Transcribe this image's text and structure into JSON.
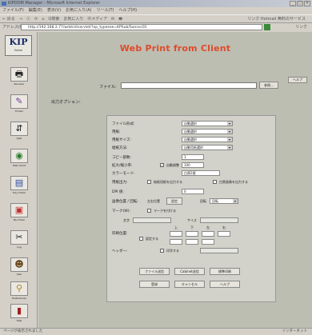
{
  "window": {
    "title": "KIPDOM Manager - Microsoft Internet Explorer"
  },
  "menubar": [
    "ファイル(F)",
    "編集(E)",
    "表示(V)",
    "お気に入り(A)",
    "ツール(T)",
    "ヘルプ(H)"
  ],
  "toolbar": {
    "items": [
      "← 戻る",
      "→",
      "ⓧ",
      "⟳",
      "⌂",
      "Q検索",
      "お気に入り",
      "Ⓜメディア",
      "✉",
      "🖶"
    ],
    "right": "リンク Hotmail 無料のサービス"
  },
  "address": {
    "label": "アドレス(D)",
    "url": "http://192.168.2.77/wdstrd/servlet/?op_typeexe=KPSub/Sansvc01",
    "links": "リンク"
  },
  "sidebar": {
    "logo": "KIP",
    "logo_label": "Home",
    "items": [
      {
        "label": "Receiver",
        "icon": "printer-icon"
      },
      {
        "label": "Printer",
        "icon": "pen-icon"
      },
      {
        "label": "Split",
        "icon": "split-icon"
      },
      {
        "label": "Web Client",
        "icon": "globe-icon"
      },
      {
        "label": "Tray Folder",
        "icon": "folder-icon"
      },
      {
        "label": "My Folder",
        "icon": "user-folder-icon"
      },
      {
        "label": "Log",
        "icon": "scissors-icon"
      },
      {
        "label": "User",
        "icon": "user-icon"
      },
      {
        "label": "Preferences",
        "icon": "search-icon"
      },
      {
        "label": "Help",
        "icon": "book-icon"
      }
    ]
  },
  "page": {
    "title": "Web Print from Client",
    "help_button": "ヘルプ",
    "file_label": "ファイル:",
    "file_value": "",
    "browse_button": "参照...",
    "options_label": "出力オプション:"
  },
  "form": {
    "rows": [
      {
        "label": "ファイル形式:",
        "value": "自動選択"
      },
      {
        "label": "用紙:",
        "value": "自動選択"
      },
      {
        "label": "用紙サイズ:",
        "value": "自動選択"
      },
      {
        "label": "給紙方法:",
        "value": "自動用紙選択"
      }
    ],
    "copies_label": "コピー部数:",
    "copies_value": "1",
    "scale_label": "拡大/縮小率:",
    "scale_check": "自動調整",
    "scale_value": "100",
    "rotation_label": "カラーモード:",
    "rotation_value": "白黒2値",
    "mirror_label": "用紙出力:",
    "mirror_opt1": "給紙用紙を出力する",
    "mirror_opt2": "白黒画像を出力する",
    "dpi_label": "DPI 値:",
    "dpi_value": "0",
    "margin_label": "画像位置 / 回転:",
    "margin_sub": "左右位置",
    "margin_btn": "設定",
    "rotate_label": "回転",
    "rotate_value": "回転",
    "watermark_label": "マーク(W):",
    "watermark_check": "マークを付ける",
    "wm_text_label": "文字",
    "wm_size_label": "サイズ",
    "stamp_label": "印刷位置:",
    "stamp_check": "設定する",
    "stamp_cols": [
      "上",
      "下",
      "左",
      "右"
    ],
    "header_label": "ヘッダー:",
    "header_check": "印字する",
    "buttons_top": [
      "ファイル送信",
      "Cabinet送信",
      "標準印刷"
    ],
    "buttons_bottom": [
      "登録",
      "キャンセル",
      "ヘルプ"
    ]
  },
  "status": {
    "left": "ページが表示されました",
    "right": "インターネット"
  }
}
